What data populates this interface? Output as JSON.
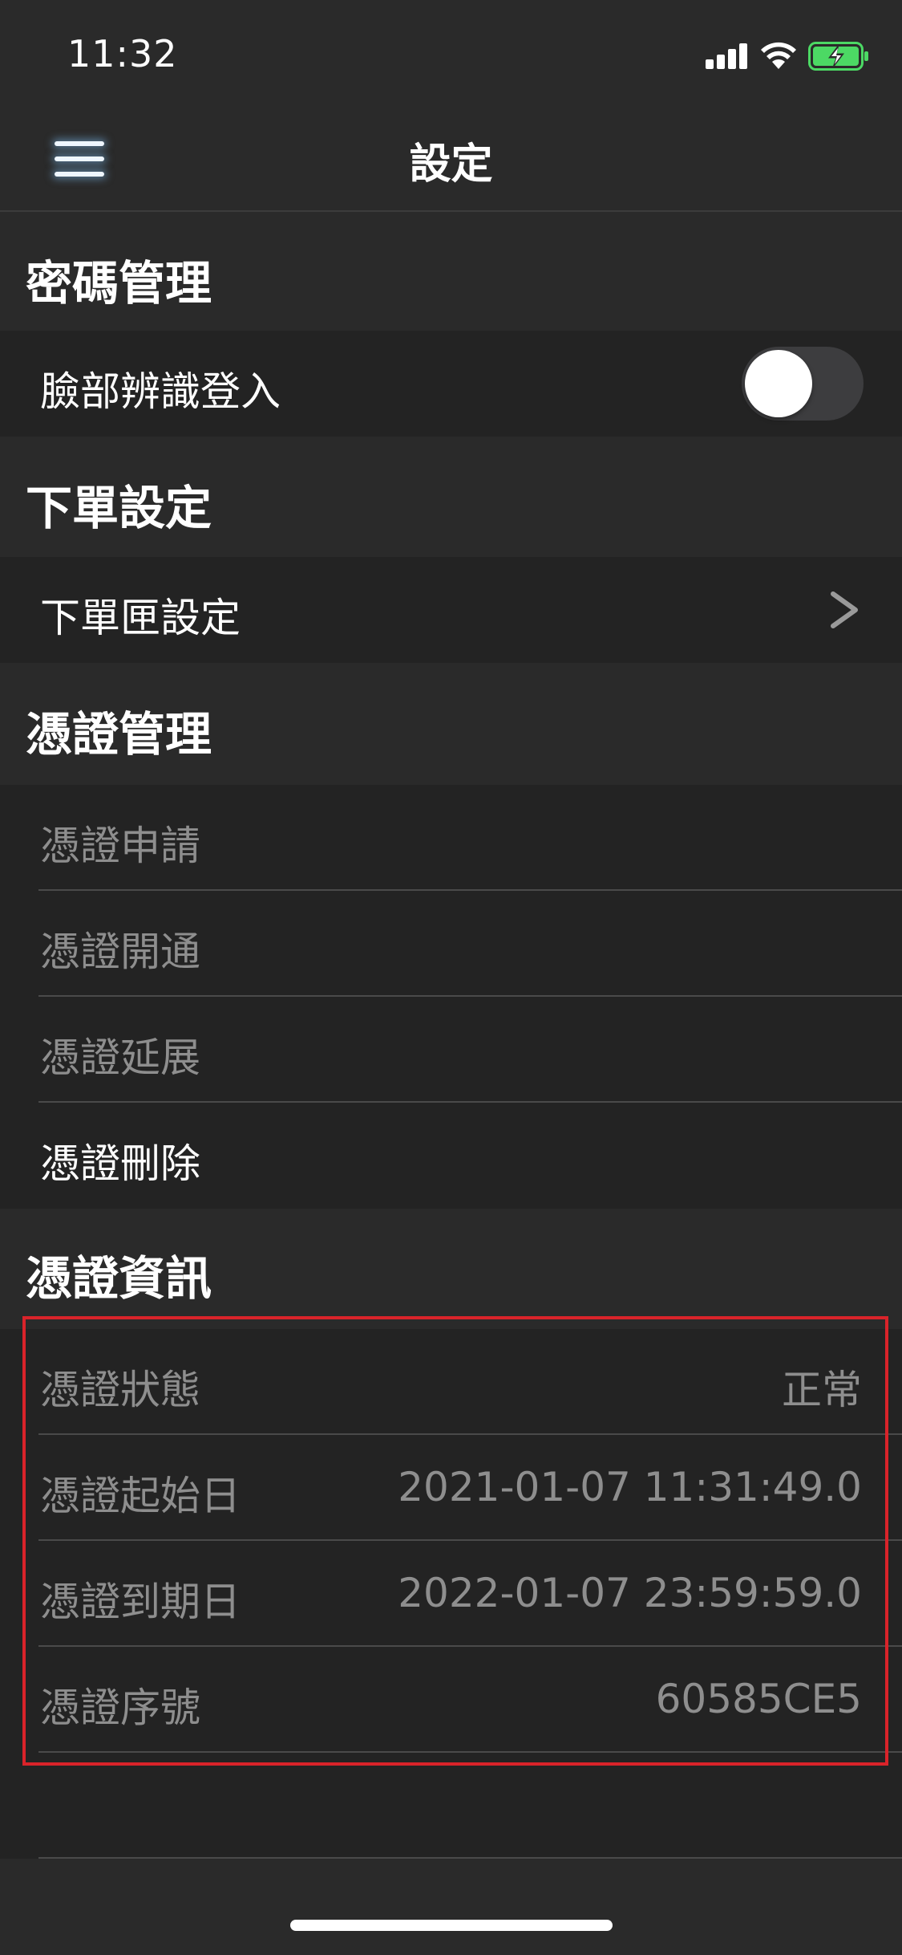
{
  "status_bar": {
    "time": "11:32"
  },
  "nav": {
    "title": "設定"
  },
  "sections": {
    "password": {
      "header": "密碼管理",
      "face_id_label": "臉部辨識登入",
      "face_id_enabled": false
    },
    "order": {
      "header": "下單設定",
      "order_box_label": "下單匣設定"
    },
    "cert_mgmt": {
      "header": "憑證管理",
      "apply": "憑證申請",
      "activate": "憑證開通",
      "extend": "憑證延展",
      "delete": "憑證刪除"
    },
    "cert_info": {
      "header": "憑證資訊",
      "status_label": "憑證狀態",
      "status_value": "正常",
      "start_label": "憑證起始日",
      "start_value": "2021-01-07 11:31:49.0",
      "expiry_label": "憑證到期日",
      "expiry_value": "2022-01-07 23:59:59.0",
      "serial_label": "憑證序號",
      "serial_value": "60585CE5"
    }
  },
  "colors": {
    "background": "#2a2a2a",
    "cell": "#232323",
    "dim_text": "#8e8e8e",
    "highlight": "#d9232a",
    "battery_charge": "#4cd964"
  }
}
